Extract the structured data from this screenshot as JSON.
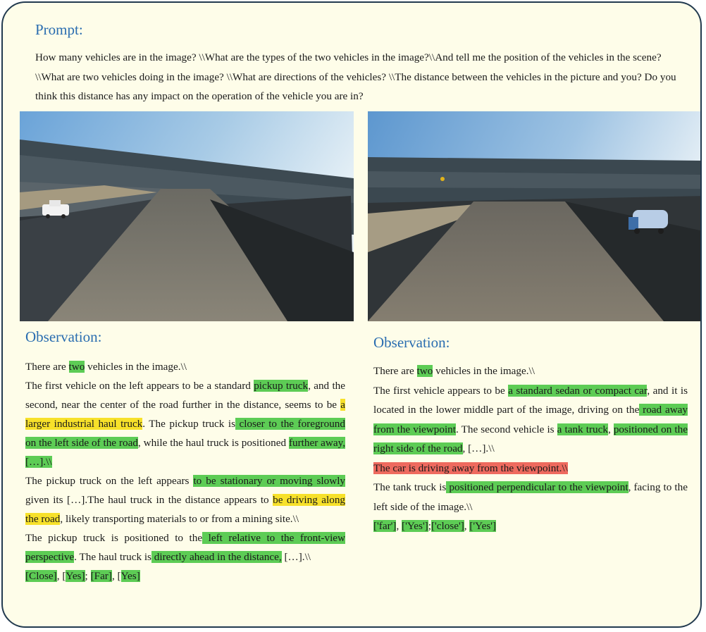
{
  "prompt": {
    "heading": "Prompt:",
    "text": "How many vehicles are in the image? \\\\What are the types of the two vehicles in the image?\\\\And tell me the position of the vehicles in the scene?\\\\What are two vehicles doing in the image? \\\\What are directions of the vehicles? \\\\The distance between the vehicles in the picture and you? Do you think this distance has any impact on the operation of the vehicle you are in?"
  },
  "colors": {
    "heading": "#2a6db0",
    "highlight_green": "#5dcc55",
    "highlight_yellow": "#f7e12a",
    "highlight_red": "#ee6a5e",
    "background": "#fefde9",
    "border": "#223a4f"
  },
  "left": {
    "heading": "Observation:",
    "p1": {
      "t1": "There are ",
      "h1": "two",
      "t2": " vehicles in the image.\\\\"
    },
    "p2": {
      "t1": "The first vehicle on the left appears to be a standard ",
      "h1": "pickup truck",
      "t2": ", and the second, near the center of the road further in the distance, seems to be ",
      "h2": "a larger industrial haul truck",
      "t3": ". The pickup truck is",
      "h3": " closer to the foreground on the left side of the road",
      "t4": ", while the haul truck is positioned ",
      "h4": "further away,[…].\\\\"
    },
    "p3": {
      "t1": "The pickup truck on the left appears ",
      "h1": "to be stationary or moving slowly ",
      "t2": "given its […].The haul truck in the distance appears to ",
      "h2": "be driving along the road",
      "t3": ", likely transporting materials to or from a mining site.\\\\"
    },
    "p4": {
      "t1": "The pickup truck is positioned to the",
      "h1": " left relative to the front-view perspective",
      "t2": ". The haul truck is",
      "h2": " directly ahead in the distance,",
      "t3": " […].\\\\"
    },
    "p5": {
      "h1": "[Close]",
      "t1": ", [",
      "h2": "Yes]",
      "t2": "; ",
      "h3": "[Far]",
      "t3": ", [",
      "h4": "Yes]"
    }
  },
  "right": {
    "heading": "Observation:",
    "p1": {
      "t1": "There are ",
      "h1": "two",
      "t2": " vehicles in the image.\\\\"
    },
    "p2": {
      "t1": "The first vehicle appears to be ",
      "h1": "a standard sedan or compact car",
      "t2": ", and it is located in the lower middle part of the image, driving on the",
      "h2": " road away from the viewpoint",
      "t3": ". The second vehicle is ",
      "h3": "a tank truck",
      "t4": ", ",
      "h4": "positioned on the right side of the road",
      "t5": ", […].\\\\"
    },
    "p3": {
      "h1": "The car is driving away from the viewpoint.\\\\"
    },
    "p4": {
      "t1": "The tank truck is",
      "h1": " positioned perpendicular to the viewpoint",
      "t2": ", facing to the left side of the image.\\\\"
    },
    "p5": {
      "h1": "['far']",
      "t1": ", ",
      "h2": "['Yes']",
      "t2": ";",
      "h3": "['close']",
      "t3": ", ",
      "h4": "['Yes']"
    }
  }
}
